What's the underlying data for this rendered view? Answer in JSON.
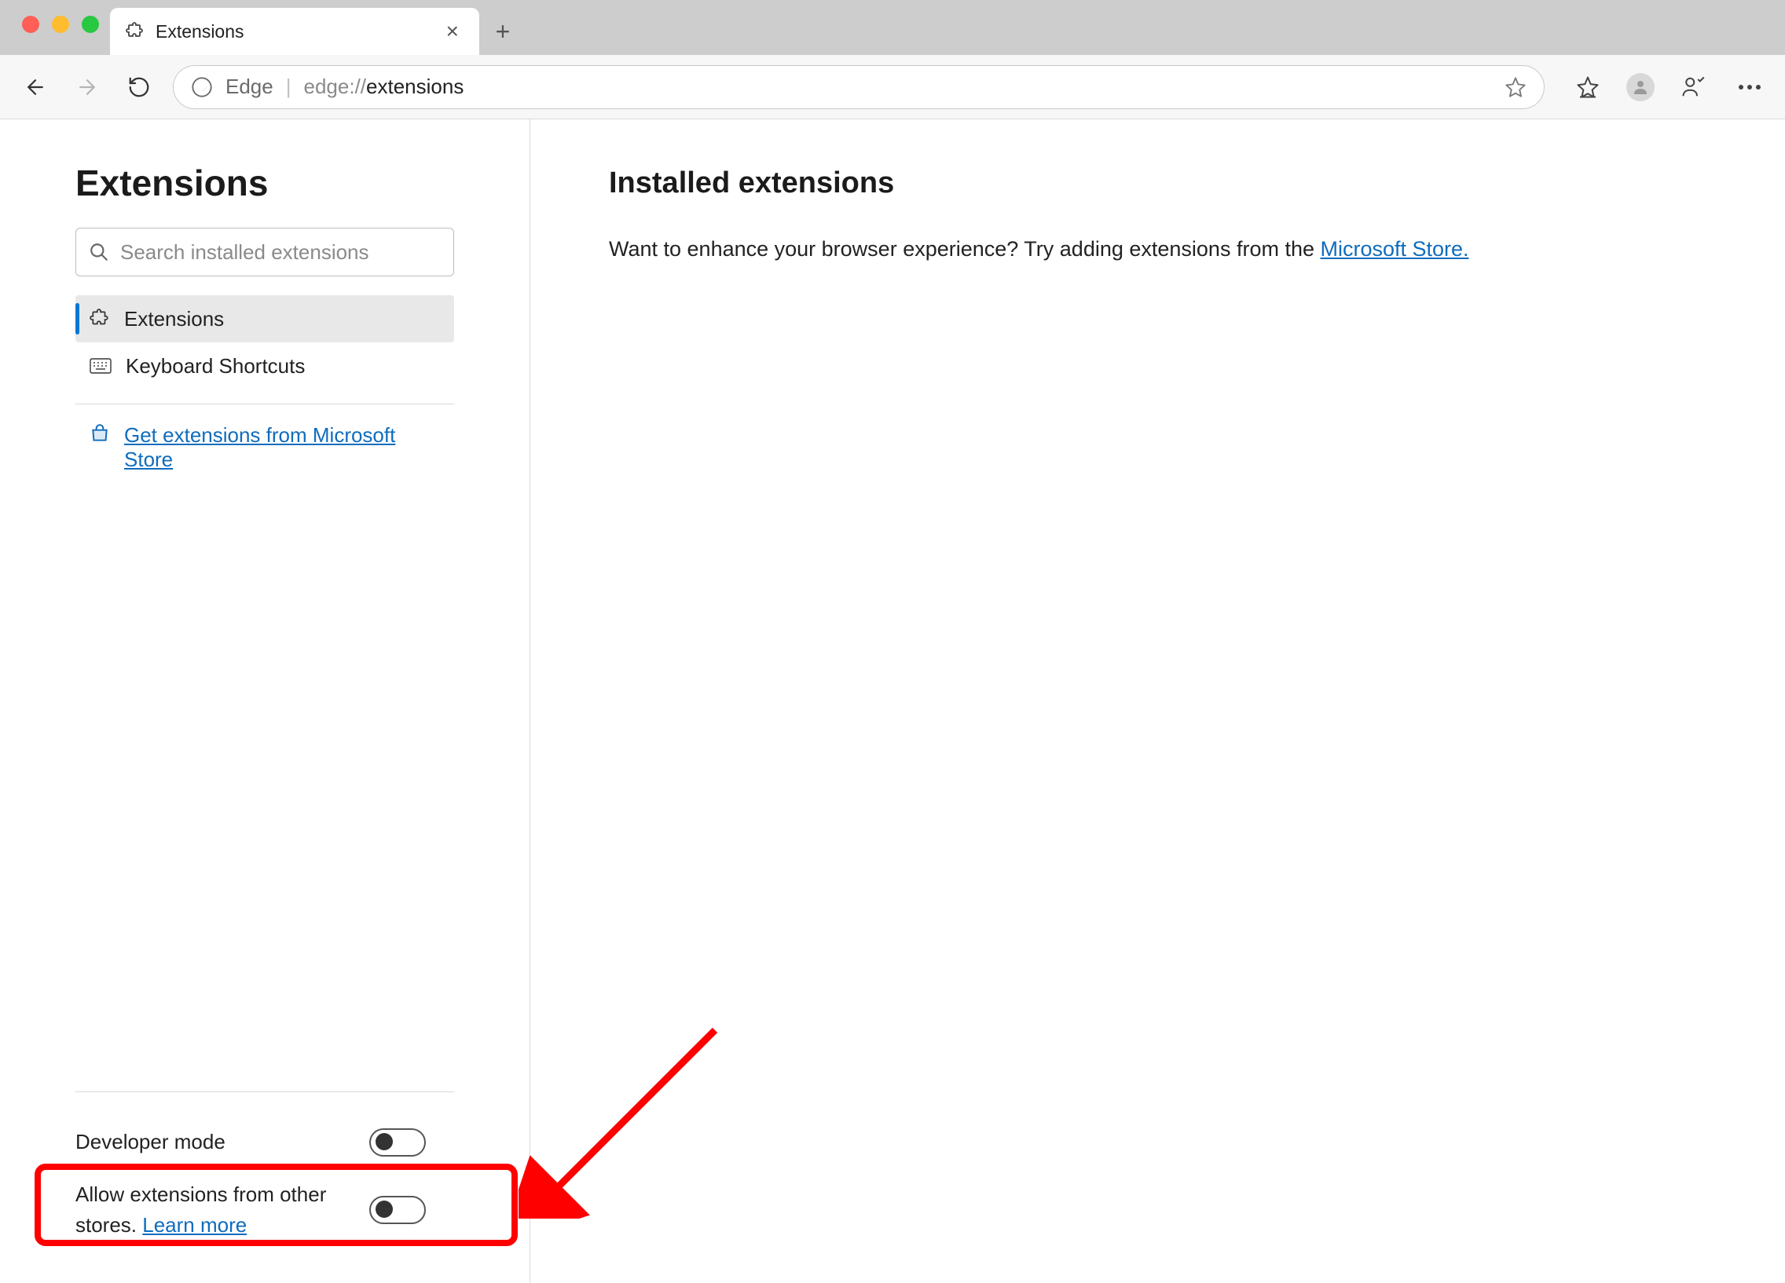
{
  "window": {
    "tab_title": "Extensions"
  },
  "toolbar": {
    "browser_label": "Edge",
    "url_dim_prefix": "edge://",
    "url_bold": "extensions"
  },
  "sidebar": {
    "title": "Extensions",
    "search_placeholder": "Search installed extensions",
    "nav": {
      "extensions": "Extensions",
      "keyboard_shortcuts": "Keyboard Shortcuts"
    },
    "store_link": "Get extensions from Microsoft Store",
    "toggles": {
      "developer_mode": "Developer mode",
      "other_stores_prefix": "Allow extensions from other stores. ",
      "other_stores_learn_more": "Learn more"
    }
  },
  "main": {
    "heading": "Installed extensions",
    "body_prefix": "Want to enhance your browser experience? Try adding extensions from the ",
    "body_link": "Microsoft Store."
  }
}
